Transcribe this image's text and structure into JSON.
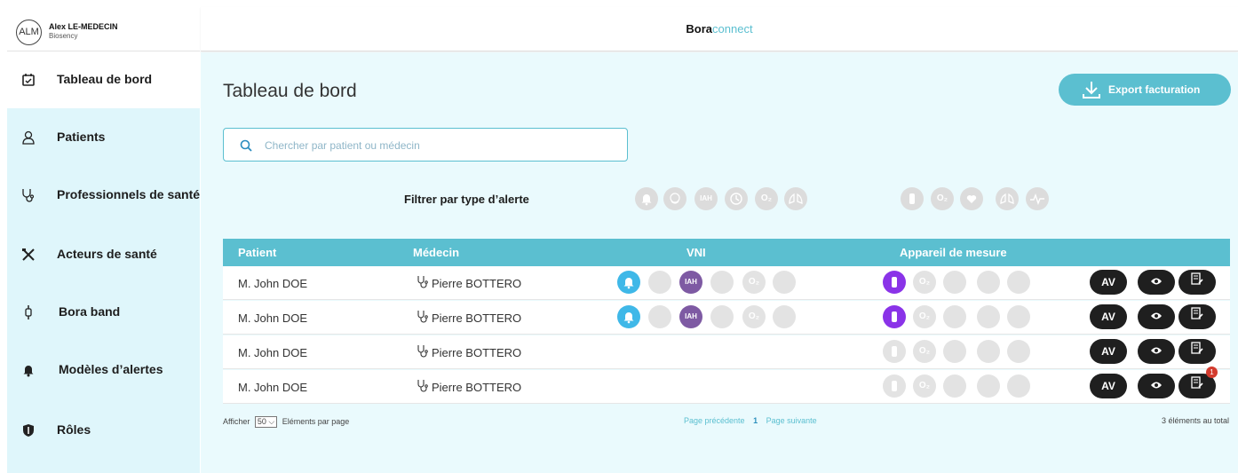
{
  "user": {
    "initials": "ALM",
    "name": "Alex LE-MEDECIN",
    "company": "Biosency"
  },
  "header": {
    "brand_bold": "Bora",
    "brand_light": "connect"
  },
  "sidebar": {
    "items": [
      {
        "label": "Tableau de bord",
        "icon": "calendar-icon",
        "active": true
      },
      {
        "label": "Patients",
        "icon": "user-icon",
        "active": false
      },
      {
        "label": "Professionnels de santé",
        "icon": "stethoscope-icon",
        "active": false
      },
      {
        "label": "Acteurs de santé",
        "icon": "tools-icon",
        "active": false
      },
      {
        "label": "Bora band",
        "icon": "watch-icon",
        "active": false
      },
      {
        "label": "Modèles d’alertes",
        "icon": "bell-icon",
        "active": false
      },
      {
        "label": "Rôles",
        "icon": "shield-icon",
        "active": false
      }
    ]
  },
  "main": {
    "title": "Tableau de bord",
    "export_label": "Export facturation",
    "search_placeholder": "Chercher par patient ou médecin",
    "filter_label": "Filtrer par type d’alerte"
  },
  "table": {
    "columns": [
      "Patient",
      "Médecin",
      "VNI",
      "Appareil de mesure"
    ],
    "rows": [
      {
        "patient": "M. John DOE",
        "doctor": "Pierre BOTTERO",
        "vni_active": true,
        "device_active": true,
        "badge": ""
      },
      {
        "patient": "M. John DOE",
        "doctor": "Pierre BOTTERO",
        "vni_active": true,
        "device_active": true,
        "badge": ""
      },
      {
        "patient": "M. John DOE",
        "doctor": "Pierre BOTTERO",
        "vni_active": false,
        "device_active": false,
        "badge": ""
      },
      {
        "patient": "M. John DOE",
        "doctor": "Pierre BOTTERO",
        "vni_active": false,
        "device_active": false,
        "badge": "1"
      }
    ],
    "action_av": "AV"
  },
  "icons": {
    "iah": "IAH",
    "o2": "O₂"
  },
  "footer": {
    "show_label": "Afficher",
    "page_size": "50",
    "per_page_label": "Eléments par page",
    "prev": "Page précédente",
    "current": "1",
    "next": "Page suivante",
    "total": "3 éléments au total"
  },
  "colors": {
    "accent": "#5bbfd0",
    "sidebar_bg": "#dff6fb",
    "alert_blue": "#3fb8e8",
    "iah_purple": "#7e5aa3",
    "device_violet": "#8a33e8"
  }
}
